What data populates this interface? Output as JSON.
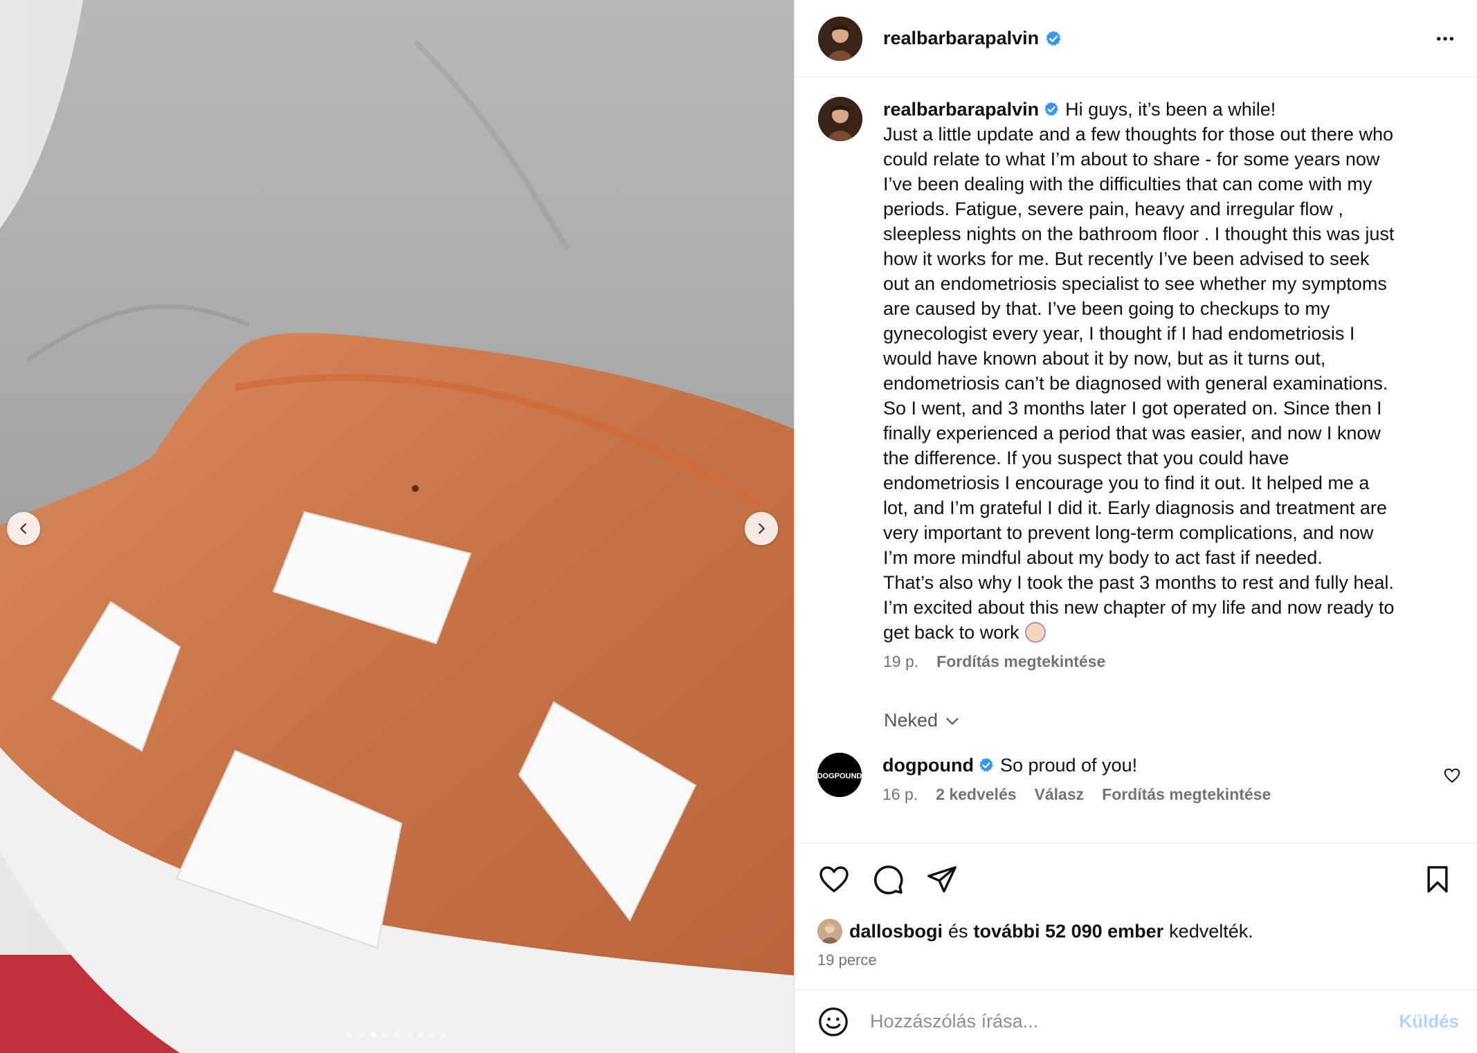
{
  "post": {
    "username": "realbarbarapalvin",
    "caption_greeting": "Hi guys, it’s been a while!",
    "caption_lines": [
      "Just a little update and a few thoughts for those out there who",
      "could relate to what I’m about to share - for some years now",
      "I’ve been dealing with the difficulties that can come with my",
      "periods. Fatigue, severe pain, heavy and irregular flow ,",
      "sleepless nights on the bathroom floor . I thought this was just",
      "how it works for me. But recently I’ve been advised to seek",
      "out an endometriosis specialist to see whether my symptoms",
      "are caused by that. I’ve been going to checkups to my",
      "gynecologist every year, I thought if I had endometriosis I",
      "would have known about it by now, but as it turns out,",
      "endometriosis can’t be diagnosed with general examinations.",
      "So I went, and 3 months later I got operated on. Since then I",
      "finally experienced a period that was easier, and now I know",
      "the difference. If you suspect that you could have",
      "endometriosis I encourage you to find it out. It helped me a",
      "lot, and I’m grateful I did it. Early diagnosis and treatment are",
      "very important to prevent long-term complications, and now",
      "I’m more mindful about my body to act fast if needed.",
      "That’s also why I took the past 3 months to rest and fully heal.",
      "I’m excited about this new chapter of my life and now ready to",
      "get back to work"
    ],
    "caption_time": "19 p.",
    "caption_translate": "Fordítás megtekintése",
    "filter_label": "Neked",
    "comment": {
      "username": "dogpound",
      "avatar_text": "DOGPOUND",
      "text": "So proud of you!",
      "time": "16 p.",
      "likes": "2 kedvelés",
      "reply": "Válasz",
      "translate": "Fordítás megtekintése"
    },
    "likes": {
      "first_user": "dallosbogi",
      "connector": "és",
      "others": "további 52 090 ember",
      "suffix": "kedvelték."
    },
    "time_ago": "19 perce",
    "compose": {
      "placeholder": "Hozzászólás írása...",
      "send_label": "Küldés"
    }
  },
  "carousel": {
    "count": 9,
    "active_index": 2
  },
  "colors": {
    "verified": "#3897f0",
    "send_disabled": "#b3d4fc",
    "meta_gray": "#737373"
  },
  "icons": [
    "verified-badge-icon",
    "more-options-icon",
    "heart-icon",
    "comment-icon",
    "share-icon",
    "bookmark-icon",
    "emoji-icon",
    "chevron-left-icon",
    "chevron-right-icon",
    "chevron-down-icon"
  ]
}
